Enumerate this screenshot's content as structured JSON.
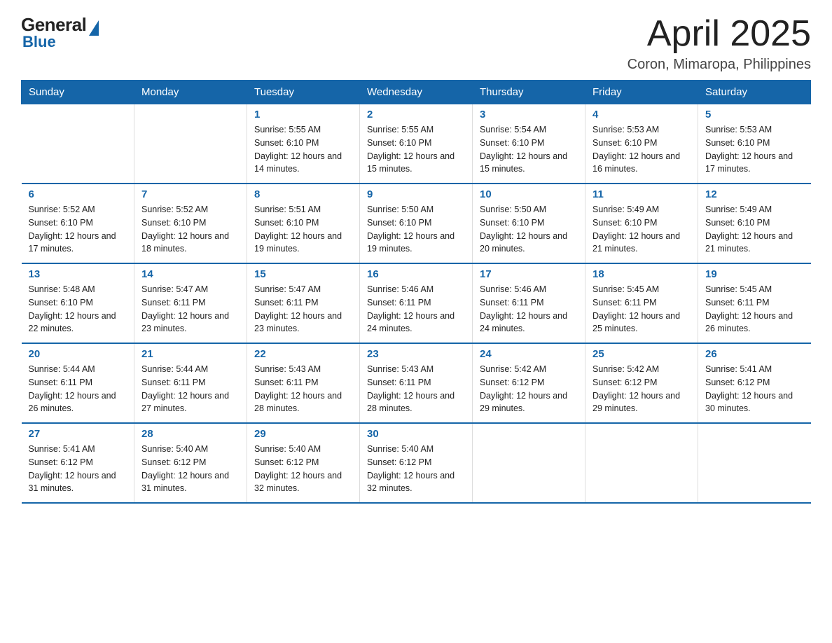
{
  "logo": {
    "general": "General",
    "blue": "Blue"
  },
  "title": {
    "month": "April 2025",
    "location": "Coron, Mimaropa, Philippines"
  },
  "weekdays": [
    "Sunday",
    "Monday",
    "Tuesday",
    "Wednesday",
    "Thursday",
    "Friday",
    "Saturday"
  ],
  "weeks": [
    [
      {
        "day": "",
        "info": ""
      },
      {
        "day": "",
        "info": ""
      },
      {
        "day": "1",
        "info": "Sunrise: 5:55 AM\nSunset: 6:10 PM\nDaylight: 12 hours\nand 14 minutes."
      },
      {
        "day": "2",
        "info": "Sunrise: 5:55 AM\nSunset: 6:10 PM\nDaylight: 12 hours\nand 15 minutes."
      },
      {
        "day": "3",
        "info": "Sunrise: 5:54 AM\nSunset: 6:10 PM\nDaylight: 12 hours\nand 15 minutes."
      },
      {
        "day": "4",
        "info": "Sunrise: 5:53 AM\nSunset: 6:10 PM\nDaylight: 12 hours\nand 16 minutes."
      },
      {
        "day": "5",
        "info": "Sunrise: 5:53 AM\nSunset: 6:10 PM\nDaylight: 12 hours\nand 17 minutes."
      }
    ],
    [
      {
        "day": "6",
        "info": "Sunrise: 5:52 AM\nSunset: 6:10 PM\nDaylight: 12 hours\nand 17 minutes."
      },
      {
        "day": "7",
        "info": "Sunrise: 5:52 AM\nSunset: 6:10 PM\nDaylight: 12 hours\nand 18 minutes."
      },
      {
        "day": "8",
        "info": "Sunrise: 5:51 AM\nSunset: 6:10 PM\nDaylight: 12 hours\nand 19 minutes."
      },
      {
        "day": "9",
        "info": "Sunrise: 5:50 AM\nSunset: 6:10 PM\nDaylight: 12 hours\nand 19 minutes."
      },
      {
        "day": "10",
        "info": "Sunrise: 5:50 AM\nSunset: 6:10 PM\nDaylight: 12 hours\nand 20 minutes."
      },
      {
        "day": "11",
        "info": "Sunrise: 5:49 AM\nSunset: 6:10 PM\nDaylight: 12 hours\nand 21 minutes."
      },
      {
        "day": "12",
        "info": "Sunrise: 5:49 AM\nSunset: 6:10 PM\nDaylight: 12 hours\nand 21 minutes."
      }
    ],
    [
      {
        "day": "13",
        "info": "Sunrise: 5:48 AM\nSunset: 6:10 PM\nDaylight: 12 hours\nand 22 minutes."
      },
      {
        "day": "14",
        "info": "Sunrise: 5:47 AM\nSunset: 6:11 PM\nDaylight: 12 hours\nand 23 minutes."
      },
      {
        "day": "15",
        "info": "Sunrise: 5:47 AM\nSunset: 6:11 PM\nDaylight: 12 hours\nand 23 minutes."
      },
      {
        "day": "16",
        "info": "Sunrise: 5:46 AM\nSunset: 6:11 PM\nDaylight: 12 hours\nand 24 minutes."
      },
      {
        "day": "17",
        "info": "Sunrise: 5:46 AM\nSunset: 6:11 PM\nDaylight: 12 hours\nand 24 minutes."
      },
      {
        "day": "18",
        "info": "Sunrise: 5:45 AM\nSunset: 6:11 PM\nDaylight: 12 hours\nand 25 minutes."
      },
      {
        "day": "19",
        "info": "Sunrise: 5:45 AM\nSunset: 6:11 PM\nDaylight: 12 hours\nand 26 minutes."
      }
    ],
    [
      {
        "day": "20",
        "info": "Sunrise: 5:44 AM\nSunset: 6:11 PM\nDaylight: 12 hours\nand 26 minutes."
      },
      {
        "day": "21",
        "info": "Sunrise: 5:44 AM\nSunset: 6:11 PM\nDaylight: 12 hours\nand 27 minutes."
      },
      {
        "day": "22",
        "info": "Sunrise: 5:43 AM\nSunset: 6:11 PM\nDaylight: 12 hours\nand 28 minutes."
      },
      {
        "day": "23",
        "info": "Sunrise: 5:43 AM\nSunset: 6:11 PM\nDaylight: 12 hours\nand 28 minutes."
      },
      {
        "day": "24",
        "info": "Sunrise: 5:42 AM\nSunset: 6:12 PM\nDaylight: 12 hours\nand 29 minutes."
      },
      {
        "day": "25",
        "info": "Sunrise: 5:42 AM\nSunset: 6:12 PM\nDaylight: 12 hours\nand 29 minutes."
      },
      {
        "day": "26",
        "info": "Sunrise: 5:41 AM\nSunset: 6:12 PM\nDaylight: 12 hours\nand 30 minutes."
      }
    ],
    [
      {
        "day": "27",
        "info": "Sunrise: 5:41 AM\nSunset: 6:12 PM\nDaylight: 12 hours\nand 31 minutes."
      },
      {
        "day": "28",
        "info": "Sunrise: 5:40 AM\nSunset: 6:12 PM\nDaylight: 12 hours\nand 31 minutes."
      },
      {
        "day": "29",
        "info": "Sunrise: 5:40 AM\nSunset: 6:12 PM\nDaylight: 12 hours\nand 32 minutes."
      },
      {
        "day": "30",
        "info": "Sunrise: 5:40 AM\nSunset: 6:12 PM\nDaylight: 12 hours\nand 32 minutes."
      },
      {
        "day": "",
        "info": ""
      },
      {
        "day": "",
        "info": ""
      },
      {
        "day": "",
        "info": ""
      }
    ]
  ]
}
